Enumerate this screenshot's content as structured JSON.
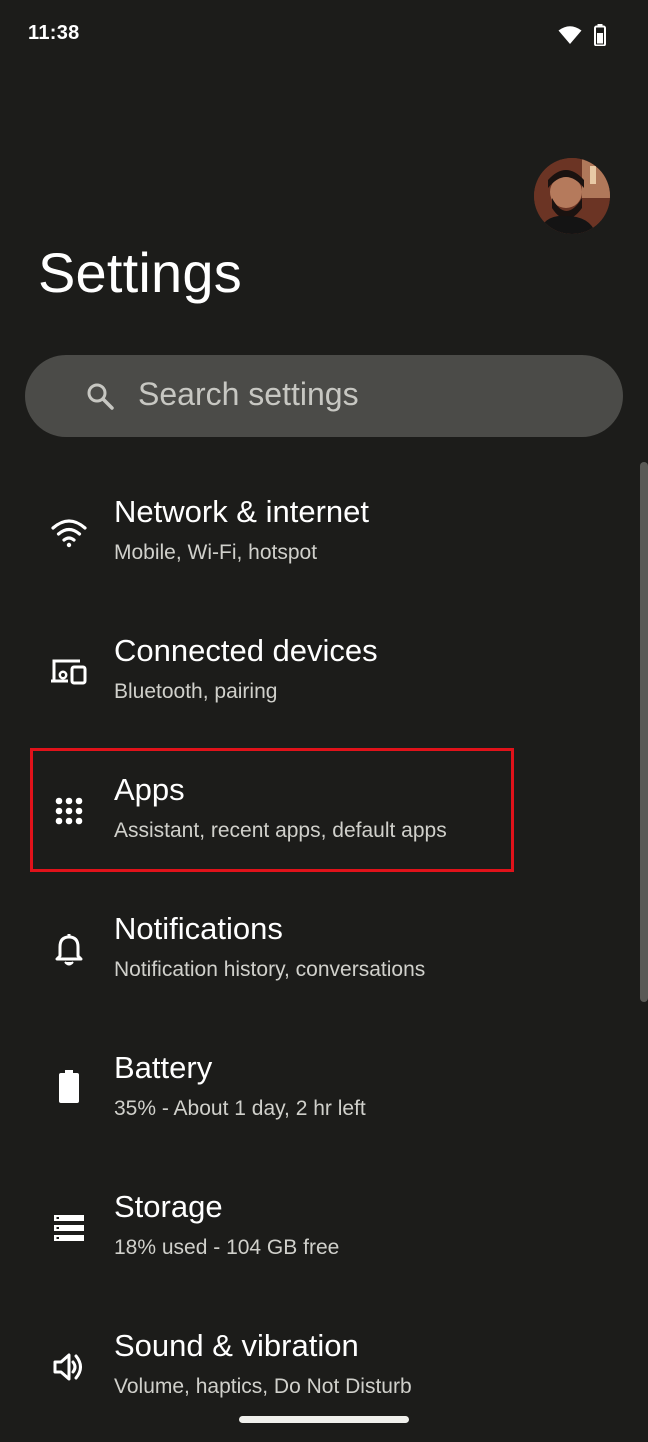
{
  "status_bar": {
    "time": "11:38",
    "icons": [
      "wifi-icon",
      "battery-icon"
    ]
  },
  "header": {
    "title": "Settings",
    "avatar": "profile-avatar"
  },
  "search": {
    "placeholder": "Search settings",
    "icon": "search-icon"
  },
  "items": [
    {
      "title": "Network & internet",
      "subtitle": "Mobile, Wi-Fi, hotspot",
      "icon": "wifi-icon"
    },
    {
      "title": "Connected devices",
      "subtitle": "Bluetooth, pairing",
      "icon": "connected-devices-icon"
    },
    {
      "title": "Apps",
      "subtitle": "Assistant, recent apps, default apps",
      "icon": "apps-grid-icon"
    },
    {
      "title": "Notifications",
      "subtitle": "Notification history, conversations",
      "icon": "bell-icon"
    },
    {
      "title": "Battery",
      "subtitle": "35% - About 1 day, 2 hr left",
      "icon": "battery-icon"
    },
    {
      "title": "Storage",
      "subtitle": "18% used - 104 GB free",
      "icon": "storage-icon"
    },
    {
      "title": "Sound & vibration",
      "subtitle": "Volume, haptics, Do Not Disturb",
      "icon": "speaker-icon"
    }
  ],
  "colors": {
    "background": "#1c1c1a",
    "search_background": "#4b4b48",
    "highlight": "#e0121a"
  }
}
